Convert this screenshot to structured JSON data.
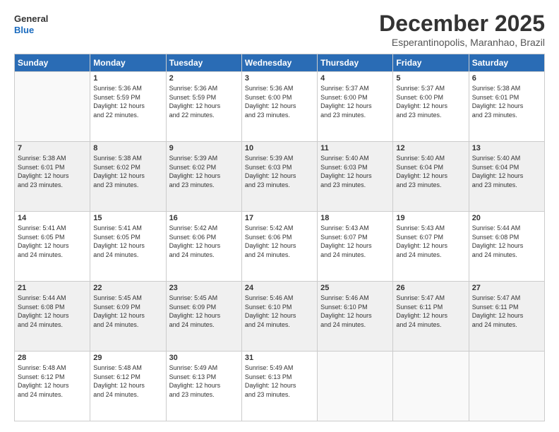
{
  "logo": {
    "line1": "General",
    "line2": "Blue"
  },
  "title": "December 2025",
  "subtitle": "Esperantinopolis, Maranhao, Brazil",
  "weekdays": [
    "Sunday",
    "Monday",
    "Tuesday",
    "Wednesday",
    "Thursday",
    "Friday",
    "Saturday"
  ],
  "weeks": [
    [
      {
        "day": "",
        "info": ""
      },
      {
        "day": "1",
        "info": "Sunrise: 5:36 AM\nSunset: 5:59 PM\nDaylight: 12 hours\nand 22 minutes."
      },
      {
        "day": "2",
        "info": "Sunrise: 5:36 AM\nSunset: 5:59 PM\nDaylight: 12 hours\nand 22 minutes."
      },
      {
        "day": "3",
        "info": "Sunrise: 5:36 AM\nSunset: 6:00 PM\nDaylight: 12 hours\nand 23 minutes."
      },
      {
        "day": "4",
        "info": "Sunrise: 5:37 AM\nSunset: 6:00 PM\nDaylight: 12 hours\nand 23 minutes."
      },
      {
        "day": "5",
        "info": "Sunrise: 5:37 AM\nSunset: 6:00 PM\nDaylight: 12 hours\nand 23 minutes."
      },
      {
        "day": "6",
        "info": "Sunrise: 5:38 AM\nSunset: 6:01 PM\nDaylight: 12 hours\nand 23 minutes."
      }
    ],
    [
      {
        "day": "7",
        "info": "Sunrise: 5:38 AM\nSunset: 6:01 PM\nDaylight: 12 hours\nand 23 minutes."
      },
      {
        "day": "8",
        "info": "Sunrise: 5:38 AM\nSunset: 6:02 PM\nDaylight: 12 hours\nand 23 minutes."
      },
      {
        "day": "9",
        "info": "Sunrise: 5:39 AM\nSunset: 6:02 PM\nDaylight: 12 hours\nand 23 minutes."
      },
      {
        "day": "10",
        "info": "Sunrise: 5:39 AM\nSunset: 6:03 PM\nDaylight: 12 hours\nand 23 minutes."
      },
      {
        "day": "11",
        "info": "Sunrise: 5:40 AM\nSunset: 6:03 PM\nDaylight: 12 hours\nand 23 minutes."
      },
      {
        "day": "12",
        "info": "Sunrise: 5:40 AM\nSunset: 6:04 PM\nDaylight: 12 hours\nand 23 minutes."
      },
      {
        "day": "13",
        "info": "Sunrise: 5:40 AM\nSunset: 6:04 PM\nDaylight: 12 hours\nand 23 minutes."
      }
    ],
    [
      {
        "day": "14",
        "info": "Sunrise: 5:41 AM\nSunset: 6:05 PM\nDaylight: 12 hours\nand 24 minutes."
      },
      {
        "day": "15",
        "info": "Sunrise: 5:41 AM\nSunset: 6:05 PM\nDaylight: 12 hours\nand 24 minutes."
      },
      {
        "day": "16",
        "info": "Sunrise: 5:42 AM\nSunset: 6:06 PM\nDaylight: 12 hours\nand 24 minutes."
      },
      {
        "day": "17",
        "info": "Sunrise: 5:42 AM\nSunset: 6:06 PM\nDaylight: 12 hours\nand 24 minutes."
      },
      {
        "day": "18",
        "info": "Sunrise: 5:43 AM\nSunset: 6:07 PM\nDaylight: 12 hours\nand 24 minutes."
      },
      {
        "day": "19",
        "info": "Sunrise: 5:43 AM\nSunset: 6:07 PM\nDaylight: 12 hours\nand 24 minutes."
      },
      {
        "day": "20",
        "info": "Sunrise: 5:44 AM\nSunset: 6:08 PM\nDaylight: 12 hours\nand 24 minutes."
      }
    ],
    [
      {
        "day": "21",
        "info": "Sunrise: 5:44 AM\nSunset: 6:08 PM\nDaylight: 12 hours\nand 24 minutes."
      },
      {
        "day": "22",
        "info": "Sunrise: 5:45 AM\nSunset: 6:09 PM\nDaylight: 12 hours\nand 24 minutes."
      },
      {
        "day": "23",
        "info": "Sunrise: 5:45 AM\nSunset: 6:09 PM\nDaylight: 12 hours\nand 24 minutes."
      },
      {
        "day": "24",
        "info": "Sunrise: 5:46 AM\nSunset: 6:10 PM\nDaylight: 12 hours\nand 24 minutes."
      },
      {
        "day": "25",
        "info": "Sunrise: 5:46 AM\nSunset: 6:10 PM\nDaylight: 12 hours\nand 24 minutes."
      },
      {
        "day": "26",
        "info": "Sunrise: 5:47 AM\nSunset: 6:11 PM\nDaylight: 12 hours\nand 24 minutes."
      },
      {
        "day": "27",
        "info": "Sunrise: 5:47 AM\nSunset: 6:11 PM\nDaylight: 12 hours\nand 24 minutes."
      }
    ],
    [
      {
        "day": "28",
        "info": "Sunrise: 5:48 AM\nSunset: 6:12 PM\nDaylight: 12 hours\nand 24 minutes."
      },
      {
        "day": "29",
        "info": "Sunrise: 5:48 AM\nSunset: 6:12 PM\nDaylight: 12 hours\nand 24 minutes."
      },
      {
        "day": "30",
        "info": "Sunrise: 5:49 AM\nSunset: 6:13 PM\nDaylight: 12 hours\nand 23 minutes."
      },
      {
        "day": "31",
        "info": "Sunrise: 5:49 AM\nSunset: 6:13 PM\nDaylight: 12 hours\nand 23 minutes."
      },
      {
        "day": "",
        "info": ""
      },
      {
        "day": "",
        "info": ""
      },
      {
        "day": "",
        "info": ""
      }
    ]
  ]
}
